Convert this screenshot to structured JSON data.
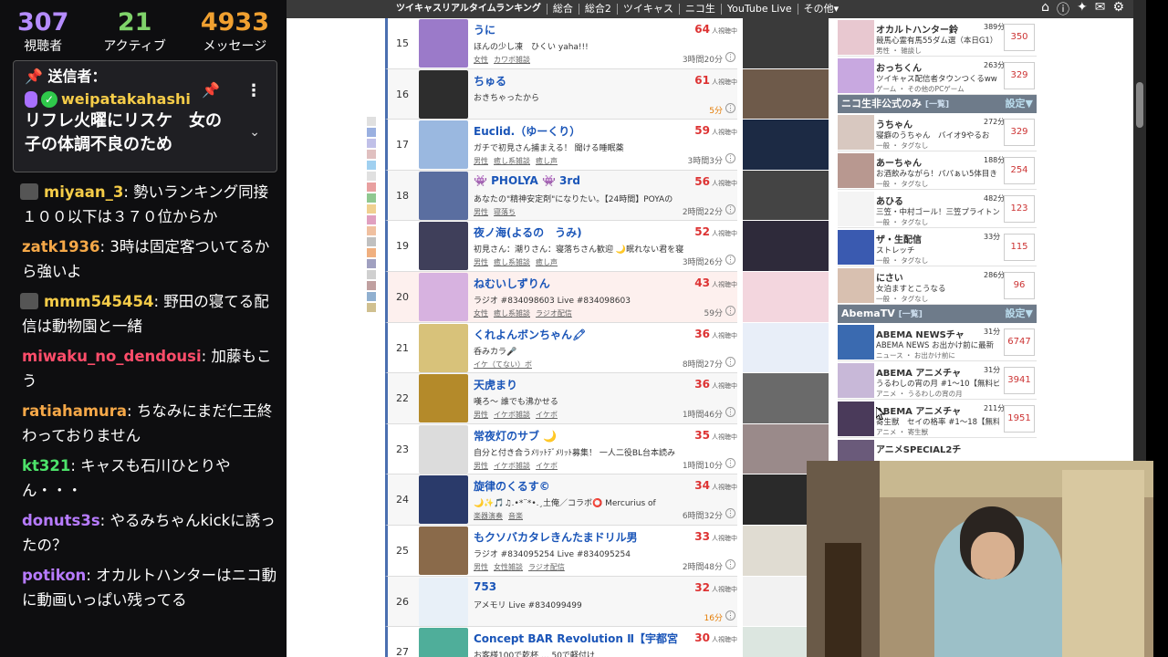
{
  "stats": {
    "viewers_num": "307",
    "viewers_label": "視聴者",
    "active_num": "21",
    "active_label": "アクティブ",
    "messages_num": "4933",
    "messages_label": "メッセージ"
  },
  "pinned": {
    "header": "送信者：",
    "user": "weipatakahashi",
    "message": "リフレ火曜にリスケ　女の子の体調不良のため"
  },
  "chat": [
    {
      "user": "miyaan_3",
      "color": "#f5cc48",
      "text": ": 勢いランキング同接１００以下は３７０位からか",
      "avatar": true
    },
    {
      "user": "zatk1936",
      "color": "#f5a848",
      "text": ": 3時は固定客ついてるから強いよ",
      "avatar": false
    },
    {
      "user": "mmm545454",
      "color": "#f5cc48",
      "text": ": 野田の寝てる配信は動物園と一緒",
      "avatar": true
    },
    {
      "user": "miwaku_no_dendousi",
      "color": "#ff4d6a",
      "text": ": 加藤もこう",
      "avatar": false
    },
    {
      "user": "ratiahamura",
      "color": "#f5a848",
      "text": ": ちなみにまだ仁王終わっておりません",
      "avatar": false
    },
    {
      "user": "kt321",
      "color": "#4de36a",
      "text": ": キャスも石川ひとりやん・・・",
      "avatar": false
    },
    {
      "user": "donuts3s",
      "color": "#b77bff",
      "text": ": やるみちゃんkickに誘ったの？",
      "avatar": false
    },
    {
      "user": "potikon",
      "color": "#b77bff",
      "text": ": オカルトハンターはニコ動に動画いっぱい残ってる",
      "avatar": false
    }
  ],
  "nav": {
    "items": [
      "ツイキャスリアルタイムランキング",
      "総合",
      "総合2",
      "ツイキャス",
      "ニコ生",
      "YouTube Live",
      "その他▾"
    ]
  },
  "rows": [
    {
      "rank": "15",
      "title": "うに",
      "desc": "ほんの少し凍　ひくい yaha!!!",
      "tags": [
        "女性",
        "カワボ雑談"
      ],
      "viewers": "64",
      "dur": "3時間20分",
      "thumb": "#9b7ac9",
      "shot": "#3a3a3a"
    },
    {
      "rank": "16",
      "title": "ちゅる",
      "desc": "おきちゃったから",
      "tags": [],
      "viewers": "61",
      "dur": "5分",
      "thumb": "#2d2d2d",
      "shot": "#6e5a4a",
      "orange": true
    },
    {
      "rank": "17",
      "title": "Euclid.（ゆーくり）",
      "desc": "ガチで初見さん捕まえる！ 聞ける睡眠薬",
      "tags": [
        "男性",
        "癒し系雑談",
        "癒し声"
      ],
      "viewers": "59",
      "dur": "3時間3分",
      "thumb": "#9ab8e0",
      "shot": "#1c2a44"
    },
    {
      "rank": "18",
      "title": "👾 PHOLYA 👾 3rd",
      "desc": "あなたの\"精神安定剤\"になりたい。【24時間】POYAの",
      "tags": [
        "男性",
        "寝落ち"
      ],
      "viewers": "56",
      "dur": "2時間22分",
      "thumb": "#5a6ea0",
      "shot": "#444"
    },
    {
      "rank": "19",
      "title": "夜ノ海(よるの　うみ)",
      "desc": "初見さん：潮りさん：寝落ちさん歓迎 🌙眠れない君を寝",
      "tags": [
        "男性",
        "癒し系雑談",
        "癒し声"
      ],
      "viewers": "52",
      "dur": "3時間26分",
      "thumb": "#3f3f5a",
      "shot": "#2e2a3a"
    },
    {
      "rank": "20",
      "title": "ねむいしずりん",
      "desc": "ラジオ #834098603 Live #834098603",
      "tags": [
        "女性",
        "癒し系雑談",
        "ラジオ配信"
      ],
      "viewers": "43",
      "dur": "59分",
      "thumb": "#d7b2e0",
      "shot": "#f3d6de",
      "hl": true
    },
    {
      "rank": "21",
      "title": "くれよんボンちゃん🖍",
      "desc": "呑みカラ🎤",
      "tags": [
        "イケ（てない）ボ"
      ],
      "viewers": "36",
      "dur": "8時間27分",
      "thumb": "#d8c27a",
      "shot": "#e8eef8"
    },
    {
      "rank": "22",
      "title": "天虎まり",
      "desc": "嘆ろ～ 誰でも沸かせる",
      "tags": [
        "男性",
        "イケボ雑談",
        "イケボ"
      ],
      "viewers": "36",
      "dur": "1時間46分",
      "thumb": "#b48a2a",
      "shot": "#6a6a6a"
    },
    {
      "rank": "23",
      "title": "常夜灯のサブ 🌙",
      "desc": "自分と付き合うﾒﾘｯﾄﾃﾞﾒﾘｯﾄ募集！ 一人二役BL台本読み",
      "tags": [
        "男性",
        "イケボ雑談",
        "イケボ"
      ],
      "viewers": "35",
      "dur": "1時間10分",
      "thumb": "#dcdcdc",
      "shot": "#9a8a8a"
    },
    {
      "rank": "24",
      "title": "旋律のくるす©",
      "desc": "🌙✨🎵♫.•*¨*•.¸土俺／コラボ⭕ Mercurius of",
      "tags": [
        "楽器演奏",
        "音楽"
      ],
      "viewers": "34",
      "dur": "6時間32分",
      "thumb": "#2a3a6a",
      "shot": "#2a2a2a"
    },
    {
      "rank": "25",
      "title": "もクソバカタレきんたまドリル男",
      "desc": "ラジオ #834095254 Live #834095254",
      "tags": [
        "男性",
        "女性雑談",
        "ラジオ配信"
      ],
      "viewers": "33",
      "dur": "2時間48分",
      "thumb": "#8a6a4a",
      "shot": "#e0dcd2"
    },
    {
      "rank": "26",
      "title": "753",
      "desc": "アメモリ Live #834099499",
      "tags": [],
      "viewers": "32",
      "dur": "16分",
      "thumb": "#e8f0f8",
      "shot": "#f2f2f2",
      "orange": true
    },
    {
      "rank": "27",
      "title": "Concept BAR Revolution Ⅱ【宇都宮",
      "desc": "お客様100で乾杯 ... 50で軽付け",
      "tags": [],
      "viewers": "30",
      "dur": "",
      "thumb": "#4fae9a",
      "shot": "#dce6e0"
    }
  ],
  "right_top": [
    {
      "name": "オカルトハンター鈴",
      "mins": "389分",
      "desc": "競馬心霊有馬55ダム選（本日G1）",
      "genre": "男性 ・ 雑談し",
      "views": "350",
      "thumb": "#e8c8d0"
    },
    {
      "name": "おっちくん",
      "mins": "263分",
      "desc": "ツイキャス配信者タウンつくるww",
      "genre": "ゲーム ・ その他のPCゲーム",
      "views": "329",
      "thumb": "#c8a8e0"
    }
  ],
  "niconico_header": {
    "title": "ニコ生非公式のみ",
    "link": "[一覧]",
    "setting": "設定▼"
  },
  "niconico": [
    {
      "name": "うちゃん",
      "mins": "272分",
      "desc": "寝癖のうちゃん　バイオ9やるお",
      "genre": "一般 ・ タグなし",
      "views": "329",
      "thumb": "#d8c8c0"
    },
    {
      "name": "あーちゃん",
      "mins": "188分",
      "desc": "お酒飲みながら！パパぁい5体目き",
      "genre": "一般 ・ タグなし",
      "views": "254",
      "thumb": "#b89890"
    },
    {
      "name": "あひる",
      "mins": "482分",
      "desc": "三笠・中村ゴール！三笠プライトン",
      "genre": "一般 ・ タグなし",
      "views": "123",
      "thumb": "#f4f4f4"
    },
    {
      "name": "ザ・生配信",
      "mins": "33分",
      "desc": "ストレッチ",
      "genre": "一般 ・ タグなし",
      "views": "115",
      "thumb": "#3a5ab0"
    },
    {
      "name": "にさい",
      "mins": "286分",
      "desc": "女泊ますとこうなる",
      "genre": "一般 ・ タグなし",
      "views": "96",
      "thumb": "#d8c0b0"
    }
  ],
  "abema_header": {
    "title": "AbemaTV",
    "link": "[一覧]",
    "setting": "設定▼"
  },
  "abema": [
    {
      "name": "ABEMA NEWSチャ",
      "mins": "31分",
      "desc": "ABEMA NEWS お出かけ前に最新",
      "genre": "ニュース ・ お出かけ前に",
      "views": "6747",
      "thumb": "#3a6ab0"
    },
    {
      "name": "ABEMA アニメチャ",
      "mins": "31分",
      "desc": "うるわしの宵の月 #1～10【無料ビ",
      "genre": "アニメ ・ うるわしの宵の月",
      "views": "3941",
      "thumb": "#c8b8d8"
    },
    {
      "name": "ABEMA アニメチャ",
      "mins": "211分",
      "desc": "寄生獣　セイの格率 #1～18【無料",
      "genre": "アニメ ・ 寄生獣",
      "views": "1951",
      "thumb": "#4a3a5a"
    },
    {
      "name": "アニメSPECIAL2チ",
      "mins": "",
      "desc": "",
      "genre": "",
      "views": "",
      "thumb": "#6a5a7a"
    }
  ]
}
